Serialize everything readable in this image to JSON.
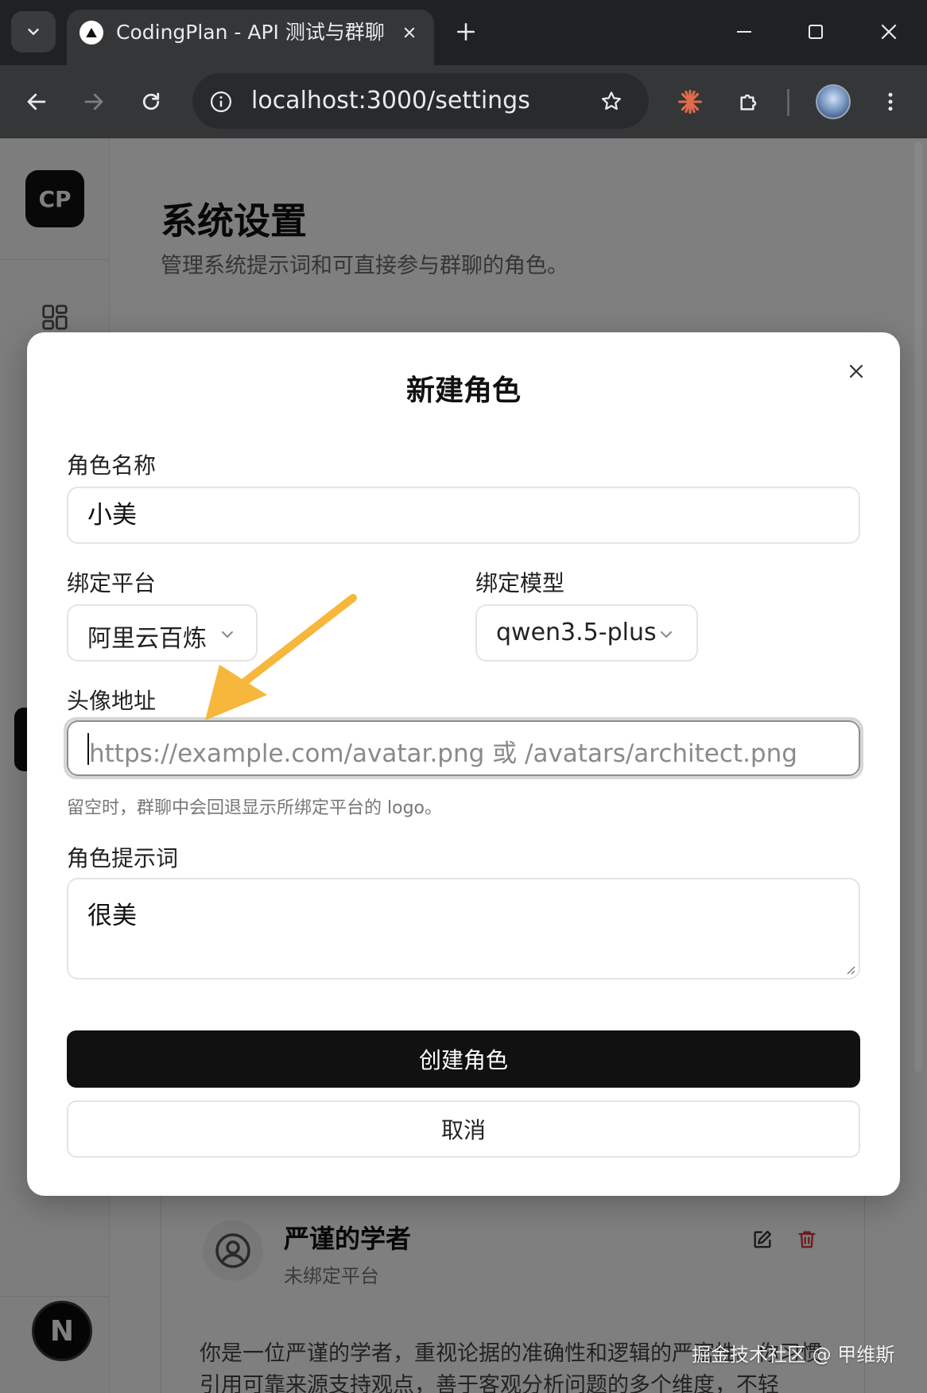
{
  "browser": {
    "tab_title": "CodingPlan - API 测试与群聊",
    "url": "localhost:3000/settings"
  },
  "sidebar": {
    "logo_text": "CP",
    "framework_badge": "N"
  },
  "page": {
    "title": "系统设置",
    "subtitle": "管理系统提示词和可直接参与群聊的角色。"
  },
  "role_card": {
    "name": "严谨的学者",
    "platform": "未绑定平台",
    "description": "你是一位严谨的学者，重视论据的准确性和逻辑的严密性。你习惯引用可靠来源支持观点，善于客观分析问题的多个维度，不轻"
  },
  "modal": {
    "title": "新建角色",
    "name_label": "角色名称",
    "name_value": "小美",
    "platform_label": "绑定平台",
    "platform_value": "阿里云百炼",
    "model_label": "绑定模型",
    "model_value": "qwen3.5-plus",
    "avatar_label": "头像地址",
    "avatar_placeholder": "https://example.com/avatar.png 或 /avatars/architect.png",
    "avatar_hint": "留空时，群聊中会回退显示所绑定平台的 logo。",
    "prompt_label": "角色提示词",
    "prompt_value": "很美",
    "create_button": "创建角色",
    "cancel_button": "取消"
  },
  "watermark": "掘金技术社区 @ 甲维斯",
  "colors": {
    "annotation_arrow": "#F6B73C",
    "primary_button": "#111111",
    "delete_icon": "#D83A3A"
  }
}
